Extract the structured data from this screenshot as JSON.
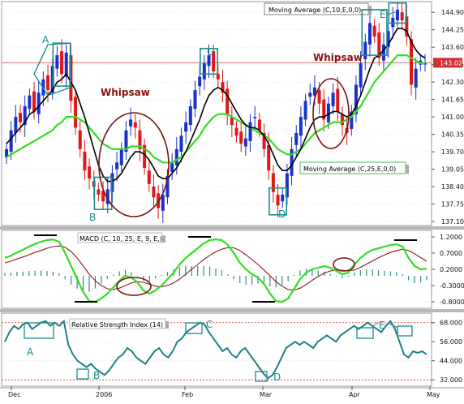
{
  "colors": {
    "up_candle": "#1a32c8",
    "down_candle": "#e01818",
    "ma10": "#000000",
    "ma25": "#33dd22",
    "macd_line": "#33dd22",
    "signal_line": "#8b1a1a",
    "histogram": "#2c8c8c",
    "rsi": "#1f7f86",
    "annotation_box": "#1a8c8c",
    "whipsaw_ellipse": "#7a1414",
    "whipsaw_text": "#8b1010",
    "price_line": "#c87070",
    "price_badge": "#d03030",
    "grid": "#d8d8d8"
  },
  "chart_data": [
    {
      "type": "candlestick",
      "panel": "price",
      "y_ticks": [
        "144.90",
        "144.25",
        "143.60",
        "142.95",
        "142.30",
        "141.65",
        "141.00",
        "140.35",
        "139.70",
        "139.05",
        "138.40",
        "137.75",
        "137.10"
      ],
      "ylim": [
        136.95,
        145.3
      ],
      "last_price": "143.02",
      "legend": [
        {
          "name": "Moving Average (C,10,E,0,0)",
          "position": "top"
        },
        {
          "name": "Moving Average (C,25,E,0,0)",
          "position": "bottom-right"
        }
      ],
      "annotations": {
        "points": [
          "A",
          "B",
          "C",
          "D",
          "E"
        ],
        "whipsaw_label": "Whipsaw"
      },
      "close_series": [
        139.8,
        140.5,
        141.0,
        140.8,
        141.4,
        141.8,
        141.2,
        141.9,
        142.4,
        142.0,
        142.9,
        143.3,
        142.6,
        143.4,
        141.6,
        140.6,
        139.8,
        139.0,
        138.7,
        138.4,
        138.1,
        137.85,
        138.3,
        138.9,
        139.3,
        139.8,
        140.5,
        140.9,
        140.6,
        139.8,
        139.1,
        138.5,
        138.0,
        137.6,
        138.1,
        138.8,
        139.3,
        139.8,
        140.3,
        140.8,
        141.4,
        142.0,
        142.5,
        143.0,
        143.3,
        142.7,
        142.4,
        141.9,
        141.1,
        140.7,
        140.3,
        140.0,
        140.2,
        140.8,
        141.0,
        140.5,
        139.8,
        139.0,
        138.2,
        137.7,
        138.1,
        138.9,
        139.8,
        140.4,
        141.0,
        141.6,
        141.9,
        142.1,
        141.5,
        140.9,
        141.5,
        141.9,
        141.2,
        140.7,
        140.4,
        141.2,
        142.2,
        143.0,
        143.8,
        144.5,
        144.0,
        143.2,
        143.7,
        144.2,
        144.7,
        145.0,
        144.6,
        144.0,
        142.2,
        142.8,
        143.1,
        143.0
      ],
      "ma10_series": [
        140.0,
        140.2,
        140.4,
        140.6,
        140.8,
        141.1,
        141.2,
        141.4,
        141.6,
        141.8,
        142.0,
        142.3,
        142.4,
        142.6,
        142.3,
        142.0,
        141.5,
        141.0,
        140.4,
        139.8,
        139.2,
        138.8,
        138.6,
        138.6,
        138.7,
        138.9,
        139.2,
        139.5,
        139.7,
        139.7,
        139.6,
        139.4,
        139.1,
        138.8,
        138.7,
        138.7,
        138.9,
        139.1,
        139.4,
        139.7,
        140.1,
        140.5,
        140.9,
        141.4,
        141.8,
        142.0,
        142.1,
        142.0,
        141.8,
        141.5,
        141.2,
        140.9,
        140.7,
        140.6,
        140.6,
        140.5,
        140.3,
        140.0,
        139.6,
        139.2,
        139.0,
        139.0,
        139.2,
        139.5,
        139.8,
        140.2,
        140.6,
        140.9,
        141.0,
        141.0,
        141.1,
        141.2,
        141.2,
        141.1,
        141.0,
        141.1,
        141.4,
        141.8,
        142.3,
        142.8,
        143.2,
        143.3,
        143.5,
        143.7,
        144.0,
        144.3,
        144.3,
        144.2,
        143.8,
        143.5,
        143.3,
        143.2
      ],
      "ma25_series": [
        139.5,
        139.6,
        139.7,
        139.8,
        139.9,
        140.0,
        140.1,
        140.2,
        140.3,
        140.4,
        140.5,
        140.7,
        140.8,
        141.0,
        141.0,
        141.0,
        140.9,
        140.8,
        140.6,
        140.4,
        140.2,
        140.0,
        139.9,
        139.8,
        139.8,
        139.8,
        139.8,
        139.9,
        139.9,
        139.9,
        139.8,
        139.7,
        139.5,
        139.4,
        139.3,
        139.3,
        139.3,
        139.4,
        139.5,
        139.7,
        139.9,
        140.1,
        140.3,
        140.6,
        140.8,
        141.0,
        141.1,
        141.1,
        141.1,
        141.0,
        140.9,
        140.8,
        140.7,
        140.6,
        140.5,
        140.4,
        140.3,
        140.2,
        140.0,
        139.8,
        139.7,
        139.6,
        139.6,
        139.7,
        139.8,
        140.0,
        140.2,
        140.4,
        140.5,
        140.6,
        140.7,
        140.8,
        140.8,
        140.8,
        140.9,
        141.0,
        141.2,
        141.4,
        141.7,
        142.0,
        142.3,
        142.5,
        142.7,
        142.9,
        143.1,
        143.3,
        143.3,
        143.3,
        143.2,
        143.1,
        143.0,
        143.0
      ]
    },
    {
      "type": "line",
      "panel": "macd",
      "name": "MACD (C, 10, 25, E, 9, E,)",
      "y_ticks": [
        "1.2000",
        "0.7000",
        "0.2000",
        "-0.3000",
        "-0.8000"
      ],
      "ylim": [
        -1.0,
        1.4
      ],
      "macd_series": [
        0.55,
        0.62,
        0.72,
        0.8,
        0.9,
        0.98,
        1.05,
        1.1,
        1.12,
        1.05,
        0.7,
        0.3,
        -0.1,
        -0.5,
        -0.78,
        -0.8,
        -0.7,
        -0.55,
        -0.35,
        -0.15,
        0.0,
        -0.05,
        -0.2,
        -0.45,
        -0.55,
        -0.45,
        -0.3,
        -0.1,
        0.1,
        0.35,
        0.55,
        0.7,
        0.85,
        1.0,
        1.1,
        1.12,
        1.1,
        0.95,
        0.7,
        0.4,
        0.2,
        0.05,
        -0.05,
        -0.25,
        -0.55,
        -0.78,
        -0.8,
        -0.7,
        -0.4,
        -0.1,
        0.1,
        0.2,
        0.25,
        0.3,
        0.25,
        0.15,
        0.05,
        0.1,
        0.35,
        0.55,
        0.7,
        0.8,
        0.85,
        0.9,
        0.95,
        0.97,
        0.9,
        0.55,
        0.3,
        0.2,
        0.22
      ],
      "signal_series": [
        0.4,
        0.45,
        0.52,
        0.58,
        0.65,
        0.72,
        0.78,
        0.85,
        0.9,
        0.92,
        0.88,
        0.75,
        0.55,
        0.3,
        0.05,
        -0.15,
        -0.3,
        -0.4,
        -0.42,
        -0.38,
        -0.3,
        -0.22,
        -0.18,
        -0.2,
        -0.26,
        -0.32,
        -0.34,
        -0.3,
        -0.22,
        -0.1,
        0.05,
        0.2,
        0.35,
        0.5,
        0.63,
        0.74,
        0.82,
        0.87,
        0.86,
        0.78,
        0.65,
        0.5,
        0.35,
        0.18,
        0.0,
        -0.18,
        -0.32,
        -0.42,
        -0.44,
        -0.38,
        -0.27,
        -0.14,
        -0.02,
        0.08,
        0.15,
        0.18,
        0.17,
        0.15,
        0.18,
        0.26,
        0.36,
        0.46,
        0.56,
        0.64,
        0.72,
        0.78,
        0.82,
        0.78,
        0.68,
        0.56,
        0.45
      ],
      "hist_series": [
        0.15,
        0.17,
        0.2,
        0.22,
        0.25,
        0.26,
        0.27,
        0.25,
        0.22,
        0.13,
        -0.18,
        -0.45,
        -0.65,
        -0.8,
        -0.83,
        -0.65,
        -0.4,
        -0.15,
        0.07,
        0.23,
        0.3,
        0.17,
        -0.02,
        -0.25,
        -0.29,
        -0.13,
        0.04,
        0.2,
        0.32,
        0.45,
        0.5,
        0.5,
        0.5,
        0.5,
        0.47,
        0.38,
        0.28,
        0.08,
        -0.16,
        -0.38,
        -0.45,
        -0.45,
        -0.4,
        -0.43,
        -0.55,
        -0.6,
        -0.48,
        -0.28,
        0.04,
        0.28,
        0.37,
        0.34,
        0.27,
        0.22,
        0.1,
        -0.03,
        -0.12,
        -0.05,
        0.17,
        0.29,
        0.34,
        0.34,
        0.29,
        0.26,
        0.23,
        0.19,
        0.08,
        -0.23,
        -0.38,
        -0.36,
        -0.23
      ]
    },
    {
      "type": "line",
      "panel": "rsi",
      "name": "Relative Strength Index (14)",
      "y_ticks": [
        "68.000",
        "56.000",
        "44.000",
        "32.000"
      ],
      "ylim": [
        28,
        74
      ],
      "levels": [
        68,
        32
      ],
      "annotations": [
        "A",
        "B",
        "C",
        "D",
        "E"
      ],
      "x_labels": [
        "Dec",
        "2006",
        "Feb",
        "Mar",
        "Apr",
        "May"
      ],
      "rsi_series": [
        56,
        62,
        66,
        64,
        67,
        68,
        64,
        66,
        68,
        69,
        66,
        68,
        66,
        69,
        54,
        48,
        44,
        42,
        40,
        42,
        39,
        37,
        35,
        38,
        42,
        46,
        48,
        52,
        50,
        46,
        44,
        42,
        46,
        50,
        52,
        48,
        46,
        50,
        56,
        58,
        62,
        64,
        66,
        68,
        67,
        62,
        58,
        54,
        50,
        52,
        48,
        46,
        50,
        52,
        48,
        44,
        40,
        36,
        33,
        35,
        40,
        46,
        52,
        54,
        56,
        54,
        56,
        54,
        52,
        56,
        58,
        60,
        58,
        56,
        60,
        62,
        64,
        66,
        64,
        66,
        68,
        66,
        64,
        62,
        66,
        69,
        64,
        56,
        48,
        46,
        50,
        49,
        50,
        48
      ]
    }
  ]
}
